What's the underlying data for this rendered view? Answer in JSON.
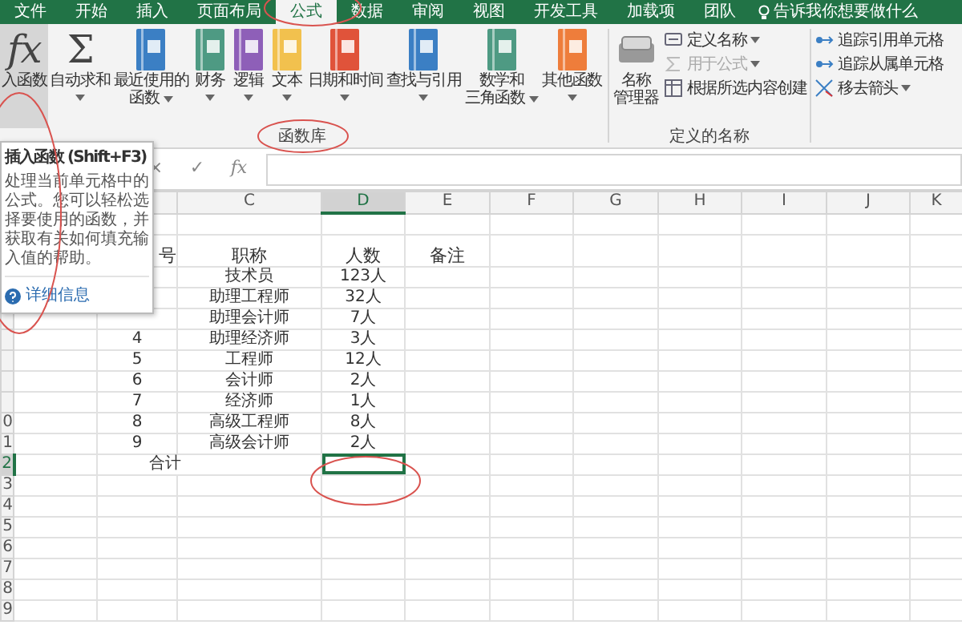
{
  "ribbon_tabs": [
    {
      "label": "文件",
      "selected": false
    },
    {
      "label": "开始",
      "selected": false
    },
    {
      "label": "插入",
      "selected": false
    },
    {
      "label": "页面布局",
      "selected": false
    },
    {
      "label": "公式",
      "selected": true
    },
    {
      "label": "数据",
      "selected": false
    },
    {
      "label": "审阅",
      "selected": false
    },
    {
      "label": "视图",
      "selected": false
    },
    {
      "label": "开发工具",
      "selected": false
    },
    {
      "label": "加载项",
      "selected": false
    },
    {
      "label": "团队",
      "selected": false
    }
  ],
  "tell_me": "告诉我你想要做什么",
  "function_library": {
    "group_label": "函数库",
    "buttons": [
      {
        "kind": "function",
        "glyph": "fx",
        "lines": [
          "入函数"
        ],
        "has_menu": false,
        "pressed": true
      },
      {
        "kind": "sum",
        "glyph": "Σ",
        "lines": [
          "自动求和"
        ],
        "has_menu": true,
        "pressed": false
      },
      {
        "kind": "book",
        "color": "#3b7fc4",
        "lines": [
          "最近使用的",
          "函数"
        ],
        "has_menu": true,
        "pressed": false
      },
      {
        "kind": "book",
        "color": "#4e9a83",
        "lines": [
          "财务"
        ],
        "has_menu": true,
        "pressed": false
      },
      {
        "kind": "book",
        "color": "#8e5fb8",
        "lines": [
          "逻辑"
        ],
        "has_menu": true,
        "pressed": false
      },
      {
        "kind": "book",
        "color": "#f2c14e",
        "lines": [
          "文本"
        ],
        "has_menu": true,
        "pressed": false
      },
      {
        "kind": "book",
        "color": "#e0533a",
        "lines": [
          "日期和时间"
        ],
        "has_menu": true,
        "pressed": false
      },
      {
        "kind": "book",
        "color": "#3b7fc4",
        "lines": [
          "查找与引用"
        ],
        "has_menu": true,
        "pressed": false
      },
      {
        "kind": "book",
        "color": "#4e9a83",
        "lines": [
          "数学和",
          "三角函数"
        ],
        "has_menu": true,
        "pressed": false
      },
      {
        "kind": "book",
        "color": "#ee7d3b",
        "lines": [
          "其他函数"
        ],
        "has_menu": true,
        "pressed": false
      }
    ]
  },
  "defined_names": {
    "group_label": "定义的名称",
    "manager": [
      "名称",
      "管理器"
    ],
    "items": [
      {
        "kind": "tag",
        "label": "定义名称",
        "has_menu": true,
        "disabled": false
      },
      {
        "kind": "formula",
        "label": "用于公式",
        "has_menu": true,
        "disabled": true
      },
      {
        "kind": "table",
        "label": "根据所选内容创建",
        "has_menu": false,
        "disabled": false
      }
    ]
  },
  "auditing": {
    "items": [
      {
        "kind": "trace",
        "label": "追踪引用单元格",
        "has_menu": false
      },
      {
        "kind": "trace",
        "label": "追踪从属单元格",
        "has_menu": false
      },
      {
        "kind": "remove",
        "label": "移去箭头",
        "has_menu": true
      }
    ]
  },
  "formula_bar": {
    "cancel": "×",
    "enter": "✓",
    "function": "fx"
  },
  "tooltip": {
    "title": "插入函数 (Shift+F3)",
    "body": "处理当前单元格中的公式。您可以轻松选择要使用的函数，并获取有关如何填充输入值的帮助。",
    "link": "详细信息"
  },
  "sheet": {
    "columns": [
      {
        "label": "C",
        "selected": false
      },
      {
        "label": "D",
        "selected": true
      },
      {
        "label": "E",
        "selected": false
      },
      {
        "label": "F",
        "selected": false
      },
      {
        "label": "G",
        "selected": false
      },
      {
        "label": "H",
        "selected": false
      },
      {
        "label": "I",
        "selected": false
      },
      {
        "label": "J",
        "selected": false
      },
      {
        "label": "K",
        "selected": false
      }
    ],
    "rows": [
      {
        "selected": false,
        "cells": {}
      },
      {
        "selected": false,
        "cells": {
          "b": "号",
          "c": "职称",
          "d": "人数",
          "e": "备注"
        }
      },
      {
        "selected": false,
        "cells": {
          "c": "技术员",
          "d": "123人"
        }
      },
      {
        "selected": false,
        "cells": {
          "c": "助理工程师",
          "d": "32人"
        }
      },
      {
        "selected": false,
        "cells": {
          "c": "助理会计师",
          "d": "7人"
        }
      },
      {
        "selected": false,
        "cells": {
          "b": "4",
          "c": "助理经济师",
          "d": "3人"
        }
      },
      {
        "selected": false,
        "cells": {
          "b": "5",
          "c": "工程师",
          "d": "12人"
        }
      },
      {
        "selected": false,
        "cells": {
          "b": "6",
          "c": "会计师",
          "d": "2人"
        }
      },
      {
        "selected": false,
        "cells": {
          "b": "7",
          "c": "经济师",
          "d": "1人"
        }
      },
      {
        "number": "0",
        "selected": false,
        "cells": {
          "b": "8",
          "c": "高级工程师",
          "d": "8人"
        }
      },
      {
        "number": "1",
        "selected": false,
        "cells": {
          "b": "9",
          "c": "高级会计师",
          "d": "2人"
        }
      },
      {
        "number": "2",
        "selected": true,
        "cells": {
          "bc": "合计"
        }
      },
      {
        "number": "3",
        "selected": false,
        "cells": {}
      },
      {
        "number": "4",
        "selected": false,
        "cells": {}
      },
      {
        "number": "5",
        "selected": false,
        "cells": {}
      },
      {
        "number": "6",
        "selected": false,
        "cells": {}
      },
      {
        "number": "7",
        "selected": false,
        "cells": {}
      },
      {
        "number": "8",
        "selected": false,
        "cells": {}
      },
      {
        "number": "9",
        "selected": false,
        "cells": {}
      }
    ]
  }
}
